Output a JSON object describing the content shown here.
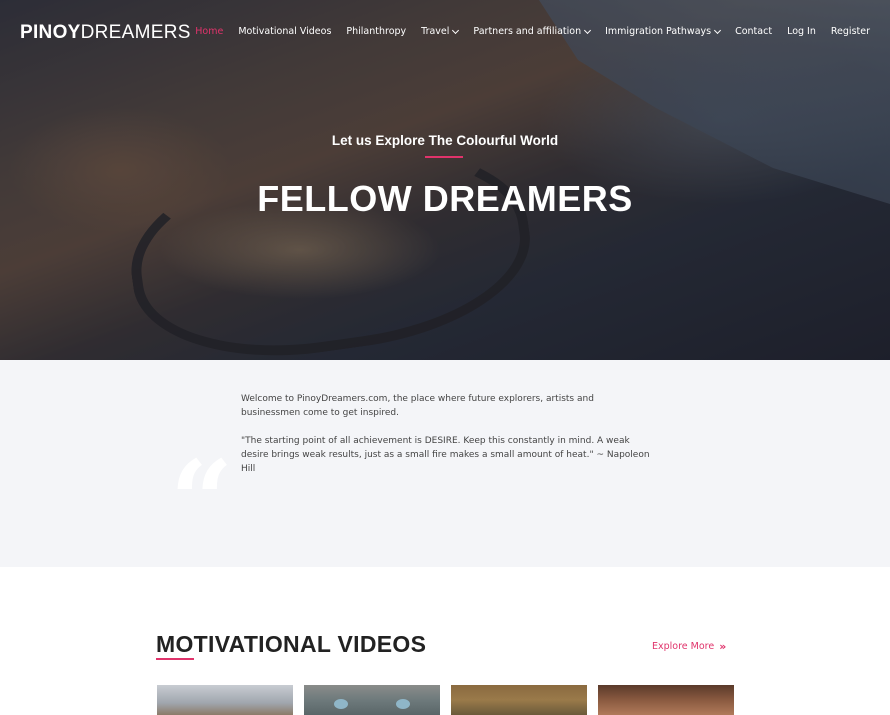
{
  "brand": {
    "part1": "PINOY",
    "part2": "DREAMERS"
  },
  "nav": {
    "items": [
      {
        "label": "Home",
        "active": true,
        "dropdown": false
      },
      {
        "label": "Motivational Videos",
        "active": false,
        "dropdown": false
      },
      {
        "label": "Philanthropy",
        "active": false,
        "dropdown": false
      },
      {
        "label": "Travel",
        "active": false,
        "dropdown": true
      },
      {
        "label": "Partners and affiliation",
        "active": false,
        "dropdown": true
      },
      {
        "label": "Immigration Pathways",
        "active": false,
        "dropdown": true
      },
      {
        "label": "Contact",
        "active": false,
        "dropdown": false
      },
      {
        "label": "Log In",
        "active": false,
        "dropdown": false
      },
      {
        "label": "Register",
        "active": false,
        "dropdown": false
      }
    ]
  },
  "hero": {
    "subtitle": "Let us Explore The Colourful World",
    "title": "FELLOW DREAMERS"
  },
  "welcome": {
    "intro": "Welcome to PinoyDreamers.com,  the place where future explorers, artists and businessmen come to get inspired.",
    "quote": "\"The starting point of all achievement is DESIRE. Keep this constantly in mind. A weak desire brings weak results, just as a small fire makes a small amount of heat.\" ~ Napoleon Hill"
  },
  "videos": {
    "title": "MOTIVATIONAL VIDEOS",
    "explore_label": "Explore More"
  },
  "colors": {
    "accent": "#e0336b",
    "section_bg": "#f4f5f8"
  }
}
